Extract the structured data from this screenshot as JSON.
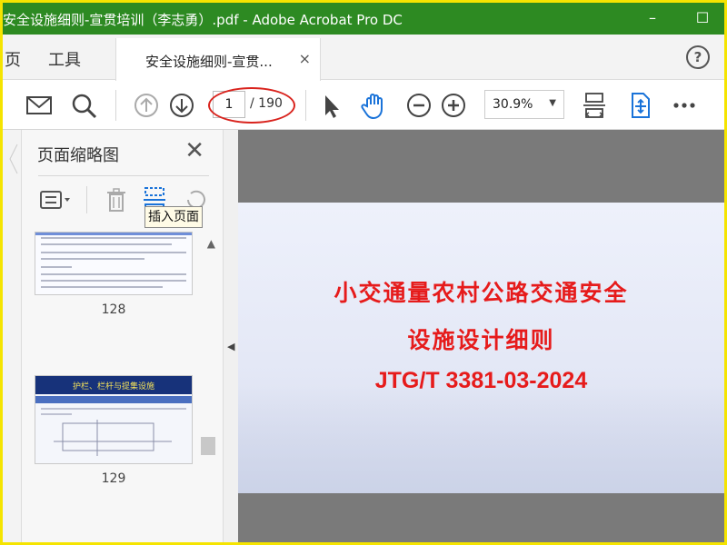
{
  "window": {
    "title": "安全设施细则-宣贯培训（李志勇）.pdf - Adobe Acrobat Pro DC",
    "minimize": "–",
    "maximize": "☐"
  },
  "tabs": {
    "home": "页",
    "tools": "工具",
    "document": "安全设施细则-宣贯...",
    "close": "×",
    "help": "?"
  },
  "toolbar": {
    "page_current": "1",
    "page_total": "/ 190",
    "zoom": "30.9%"
  },
  "thumbnail_panel": {
    "title": "页面缩略图",
    "close": "✕",
    "tooltip": "插入页面",
    "pages": [
      {
        "label": "128"
      },
      {
        "label": "129",
        "heading": "护栏、栏杆与提集设施"
      }
    ]
  },
  "document": {
    "line1": "小交通量农村公路交通安全",
    "line2": "设施设计细则",
    "code": "JTG/T 3381-03-2024"
  },
  "colors": {
    "titlebar": "#2d8a22",
    "doc_text": "#e61b1b",
    "icon_blue": "#1a73d9",
    "highlight_ellipse": "#d9231d"
  }
}
